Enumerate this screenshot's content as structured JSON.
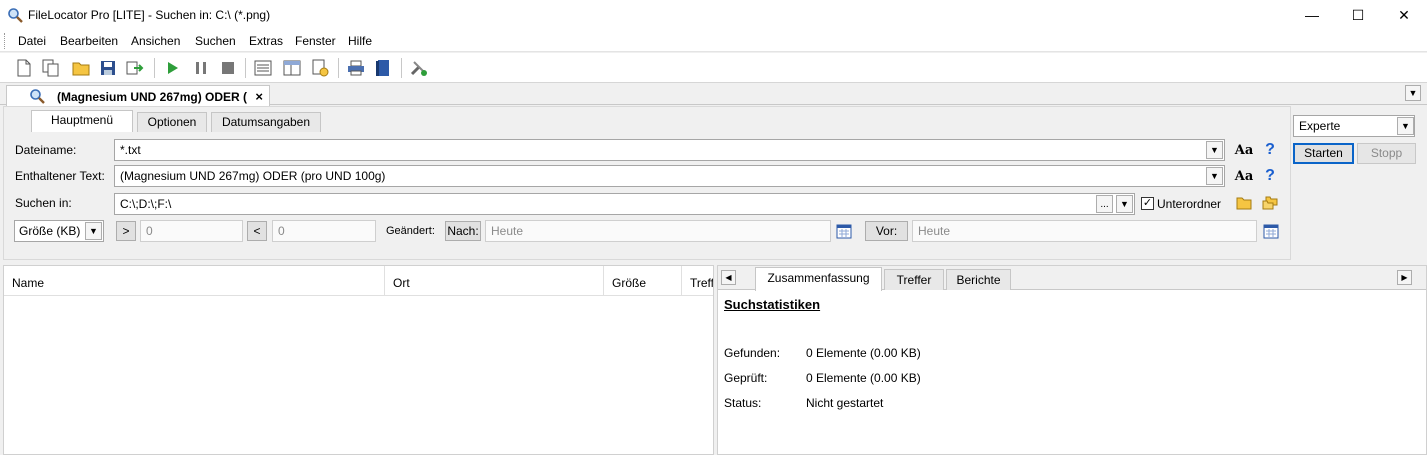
{
  "window": {
    "title": "FileLocator Pro [LITE] - Suchen in: C:\\ (*.png)",
    "minimize": "—",
    "maximize": "☐",
    "close": "✕"
  },
  "menu": [
    "Datei",
    "Bearbeiten",
    "Ansichen",
    "Suchen",
    "Extras",
    "Fenster",
    "Hilfe"
  ],
  "doc_tab": {
    "label": "(Magnesium UND 267mg) ODER (",
    "close": "×"
  },
  "criteria_tabs": [
    "Hauptmenü",
    "Optionen",
    "Datumsangaben"
  ],
  "form": {
    "filename_label": "Dateiname:",
    "filename_value": "*.txt",
    "text_label": "Enthaltener Text:",
    "text_value": "(Magnesium UND 267mg) ODER (pro UND 100g)",
    "lookin_label": "Suchen in:",
    "lookin_value": "C:\\;D:\\;F:\\",
    "browse_label": "...",
    "subfolders_label": "Unterordner",
    "aa_label": "Aa",
    "help_label": "?",
    "size_unit": "Größe (KB)",
    "gt_label": ">",
    "gt_value": "0",
    "lt_label": "<",
    "lt_value": "0",
    "changed_label": "Geändert:",
    "after_label": "Nach:",
    "after_value": "Heute",
    "before_label": "Vor:",
    "before_value": "Heute"
  },
  "command": {
    "mode": "Experte",
    "start": "Starten",
    "stop": "Stopp"
  },
  "results": {
    "columns": [
      "Name",
      "Ort",
      "Größe",
      "Treff"
    ]
  },
  "summary": {
    "tabs": [
      "Zusammenfassung",
      "Treffer",
      "Berichte"
    ],
    "heading": "Suchstatistiken",
    "rows": [
      {
        "label": "Gefunden:",
        "value": "0 Elemente (0.00 KB)"
      },
      {
        "label": "Geprüft:",
        "value": "0 Elemente (0.00 KB)"
      },
      {
        "label": "Status:",
        "value": "Nicht gestartet"
      }
    ]
  },
  "icons": {
    "app": "magnifier-icon",
    "accent": "#1a5fcf",
    "play_color": "#2e9e3a"
  }
}
